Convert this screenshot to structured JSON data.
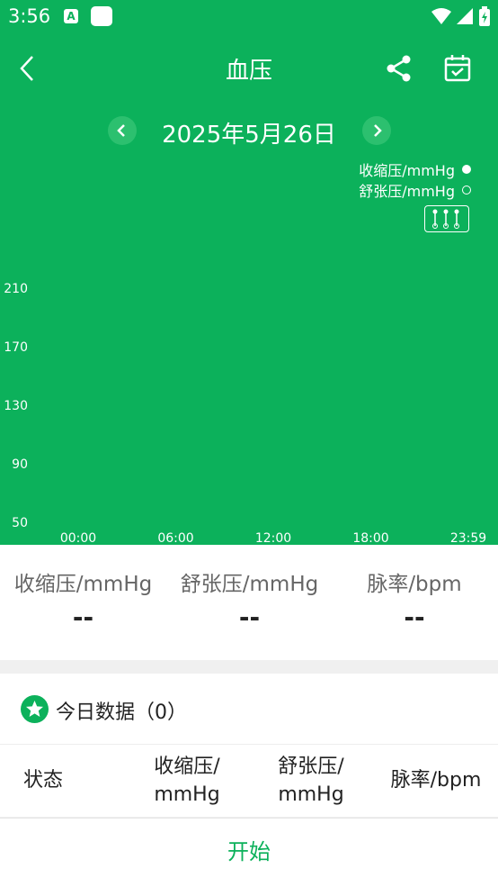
{
  "status_bar": {
    "time": "3:56",
    "icon_a_letter": "A"
  },
  "app_bar": {
    "title": "血压"
  },
  "date_bar": {
    "date": "2025年5月26日"
  },
  "colors": {
    "primary": "#0cb15b",
    "white": "#ffffff",
    "divider": "#f0f0f0"
  },
  "icons": {
    "back": "chevron-left-icon",
    "share": "share-icon",
    "calendar": "calendar-check-icon",
    "prev": "chevron-left-circle-icon",
    "next": "chevron-right-circle-icon",
    "legend_toggle": "sliders-icon",
    "star": "star-icon"
  },
  "chart_data": {
    "type": "scatter",
    "series": [
      {
        "name": "收缩压/mmHg",
        "marker": "filled",
        "values": []
      },
      {
        "name": "舒张压/mmHg",
        "marker": "hollow",
        "values": []
      }
    ],
    "x_ticks": [
      "00:00",
      "06:00",
      "12:00",
      "18:00",
      "23:59"
    ],
    "y_ticks": [
      210,
      170,
      130,
      90,
      50
    ],
    "ylim": [
      50,
      210
    ],
    "legend_position": "top-right",
    "grid": false
  },
  "summary": {
    "items": [
      {
        "label": "收缩压/mmHg",
        "value": "--"
      },
      {
        "label": "舒张压/mmHg",
        "value": "--"
      },
      {
        "label": "脉率/bpm",
        "value": "--"
      }
    ]
  },
  "today": {
    "label": "今日数据（0）"
  },
  "table": {
    "headers": [
      {
        "line1": "状态",
        "line2": ""
      },
      {
        "line1": "收缩压/",
        "line2": "mmHg"
      },
      {
        "line1": "舒张压/",
        "line2": "mmHg"
      },
      {
        "line1": "脉率/bpm",
        "line2": ""
      }
    ]
  },
  "actions": {
    "start": "开始"
  }
}
